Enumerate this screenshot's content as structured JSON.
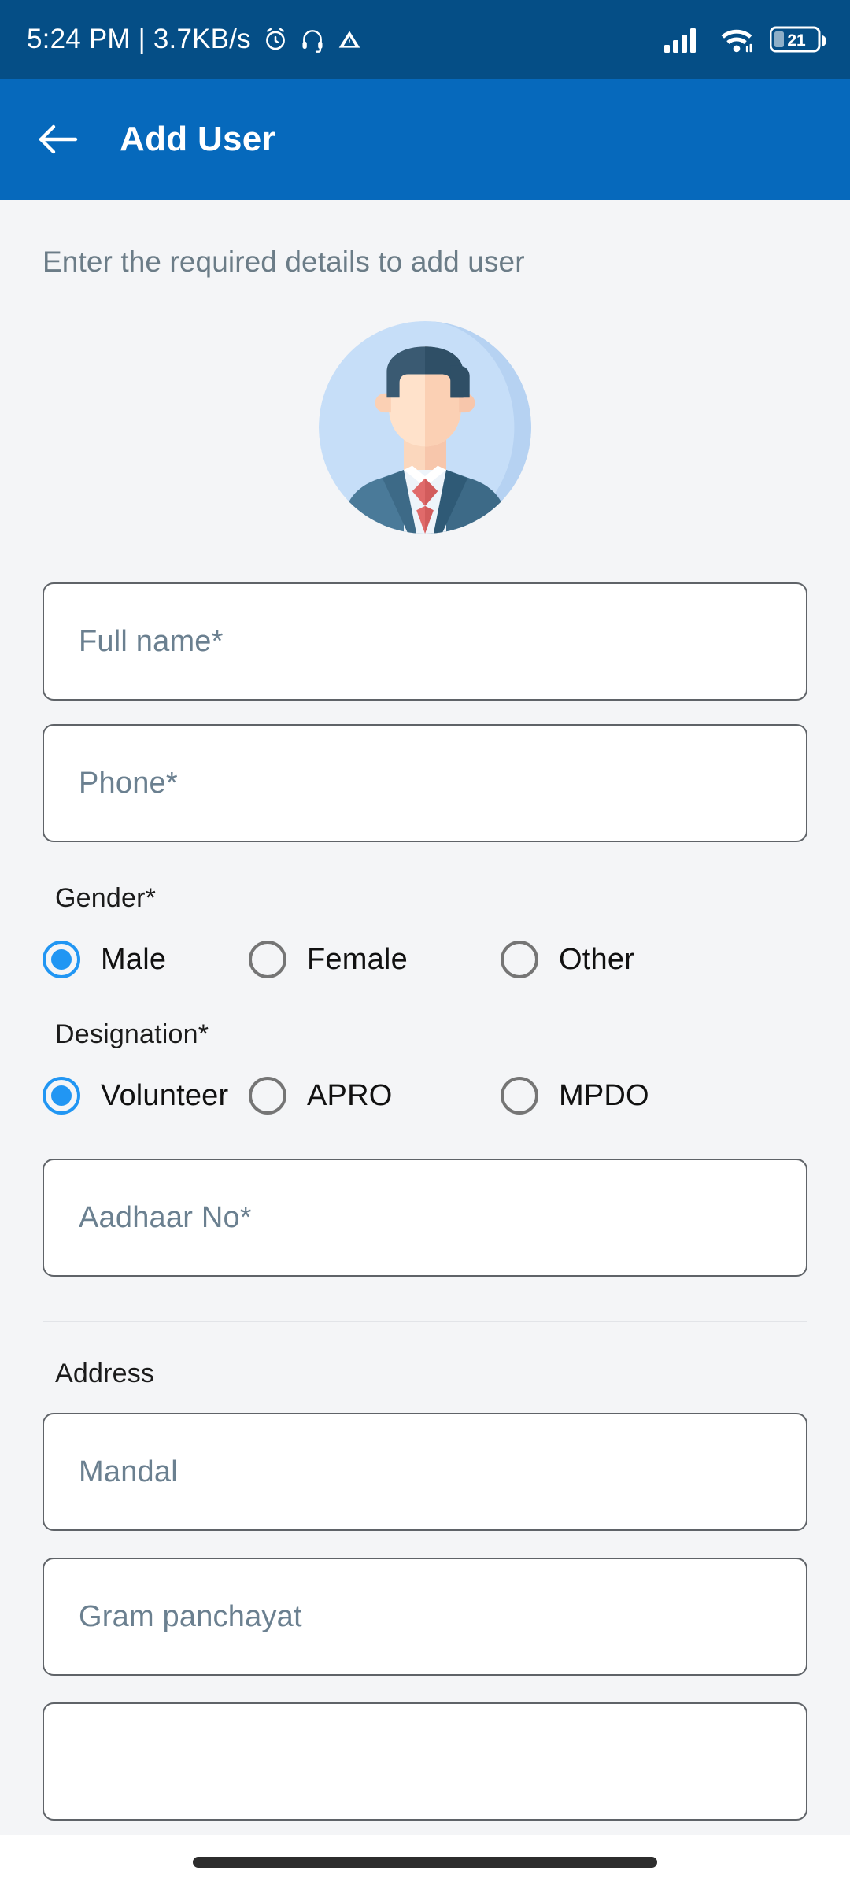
{
  "status_bar": {
    "time_and_network": "5:24 PM | 3.7KB/s",
    "icons": [
      "alarm-icon",
      "headphones-icon",
      "vpn-icon",
      "cellular-signal-icon",
      "wifi-icon"
    ],
    "battery_level": "21",
    "background_color": "#054e86"
  },
  "app_bar": {
    "back_icon": "arrow-left-icon",
    "title": "Add User",
    "background_color": "#0669bc"
  },
  "content": {
    "subtitle": "Enter the required details to add user",
    "avatar_icon": "user-avatar-illustration",
    "fields": [
      {
        "name": "full-name",
        "placeholder": "Full name*",
        "value": ""
      },
      {
        "name": "phone",
        "placeholder": "Phone*",
        "value": ""
      },
      {
        "name": "aadhaar",
        "placeholder": "Aadhaar No*",
        "value": ""
      }
    ],
    "gender": {
      "label": "Gender*",
      "options": [
        {
          "label": "Male",
          "selected": true
        },
        {
          "label": "Female",
          "selected": false
        },
        {
          "label": "Other",
          "selected": false
        }
      ]
    },
    "designation": {
      "label": "Designation*",
      "options": [
        {
          "label": "Volunteer",
          "selected": true
        },
        {
          "label": "APRO",
          "selected": false
        },
        {
          "label": "MPDO",
          "selected": false
        }
      ]
    },
    "address": {
      "section_title": "Address",
      "fields": [
        {
          "name": "mandal",
          "placeholder": "Mandal",
          "value": ""
        },
        {
          "name": "gram-panchayat",
          "placeholder": "Gram panchayat",
          "value": ""
        },
        {
          "name": "village",
          "placeholder": "",
          "value": ""
        }
      ]
    }
  },
  "theme": {
    "accent": "#2196f3",
    "primary": "#0669bc",
    "page_background": "#f4f5f7",
    "field_border": "#5f6368",
    "placeholder_color": "#6b8090"
  }
}
